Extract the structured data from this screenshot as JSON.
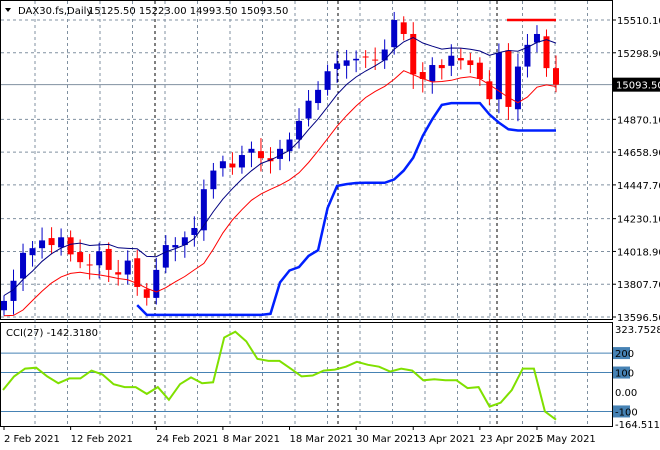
{
  "header": {
    "symbol_label": "DAX30.fs,Daily",
    "ohlc": "15125.50 15223.00 14993.50 15093.50"
  },
  "current_price_label": "15093.50",
  "colors": {
    "up": "#0000c8",
    "down": "#ff0000",
    "ma_upper": "#000080",
    "ma_lower": "#ff0000",
    "support": "#0020ff",
    "cci": "#80e000",
    "grid": "#8090a0"
  },
  "chart_data": [
    {
      "type": "candlestick",
      "title": "DAX30.fs,Daily",
      "ylim": [
        13596.5,
        15510.1
      ],
      "y_ticks": [
        "15510.10",
        "15298.90",
        "15093.50",
        "14870.10",
        "14658.90",
        "14447.70",
        "14230.10",
        "14018.90",
        "13807.70",
        "13596.50"
      ],
      "y_tick_values": [
        15510.1,
        15298.9,
        15093.5,
        14870.1,
        14658.9,
        14447.7,
        14230.1,
        14018.9,
        13807.7,
        13596.5
      ],
      "x_ticks": [
        "2 Feb 2021",
        "12 Feb 2021",
        "24 Feb 2021",
        "8 Mar 2021",
        "18 Mar 2021",
        "30 Mar 2021",
        "13 Apr 2021",
        "23 Apr 2021",
        "5 May 2021"
      ],
      "x_tick_bar_index": [
        0,
        7,
        16,
        23,
        30,
        37,
        43,
        50,
        56
      ],
      "closes": [
        13700,
        13830,
        14010,
        14040,
        14090,
        14060,
        14110,
        14000,
        13950,
        13930,
        14020,
        13900,
        13870,
        13960,
        13790,
        13720,
        13900,
        14060,
        14060,
        14110,
        14170,
        14420,
        14540,
        14600,
        14560,
        14640,
        14680,
        14620,
        14600,
        14680,
        14740,
        14860,
        14990,
        15060,
        15180,
        15230,
        15250,
        15260,
        15270,
        15250,
        15320,
        15510,
        15420,
        15160,
        15130,
        15220,
        15200,
        15280,
        15250,
        15220,
        15130,
        15000,
        15300,
        14950,
        15210,
        15350,
        15420,
        15200,
        15093.5
      ],
      "resistance_level": 15510.1,
      "current_price": 15093.5
    },
    {
      "type": "line",
      "title": "CCI(27) -142.3180",
      "ylim": [
        -164.5118,
        323.7528
      ],
      "levels": [
        200,
        100,
        0,
        -100
      ],
      "level_labels": [
        "200",
        "100",
        "0.00",
        "-100"
      ],
      "max_label": "323.7528",
      "min_label": "-164.5118",
      "values": [
        10,
        80,
        120,
        125,
        80,
        45,
        70,
        70,
        110,
        90,
        40,
        25,
        25,
        -10,
        25,
        -40,
        40,
        75,
        45,
        50,
        280,
        310,
        260,
        170,
        160,
        160,
        120,
        80,
        85,
        110,
        115,
        130,
        155,
        140,
        130,
        105,
        120,
        110,
        60,
        65,
        60,
        60,
        20,
        25,
        -75,
        -55,
        10,
        120,
        120,
        -100,
        -142.318
      ]
    }
  ]
}
